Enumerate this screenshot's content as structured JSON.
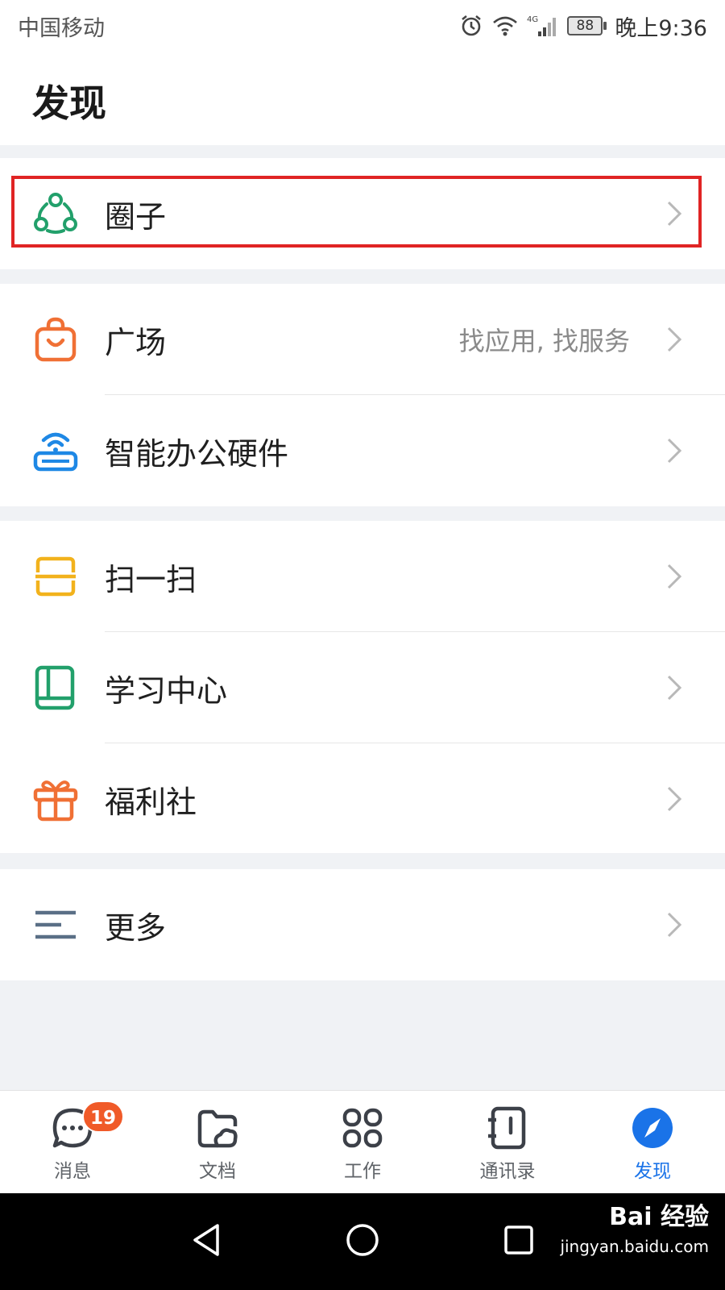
{
  "status_bar": {
    "carrier": "中国移动",
    "network": "4G",
    "battery": "88",
    "time": "晚上9:36"
  },
  "page": {
    "title": "发现"
  },
  "menu": {
    "circle": {
      "label": "圈子",
      "icon": "circle-network-icon",
      "color": "#22a06b"
    },
    "plaza": {
      "label": "广场",
      "sub": "找应用, 找服务",
      "icon": "shopping-bag-icon",
      "color": "#f07035"
    },
    "hardware": {
      "label": "智能办公硬件",
      "icon": "router-icon",
      "color": "#1e88e5"
    },
    "scan": {
      "label": "扫一扫",
      "icon": "scan-icon",
      "color": "#f2b21c"
    },
    "learning": {
      "label": "学习中心",
      "icon": "book-icon",
      "color": "#22a06b"
    },
    "welfare": {
      "label": "福利社",
      "icon": "gift-icon",
      "color": "#f07035"
    },
    "more": {
      "label": "更多",
      "icon": "menu-lines-icon",
      "color": "#5a6f86"
    }
  },
  "tabbar": {
    "messages": {
      "label": "消息",
      "badge": "19",
      "icon": "chat-icon"
    },
    "docs": {
      "label": "文档",
      "icon": "folder-icon"
    },
    "work": {
      "label": "工作",
      "icon": "apps-grid-icon"
    },
    "contacts": {
      "label": "通讯录",
      "icon": "address-book-icon"
    },
    "discover": {
      "label": "发现",
      "icon": "compass-icon",
      "active_color": "#1a73e8"
    }
  },
  "watermark": {
    "brand": "Bai 经验",
    "url": "jingyan.baidu.com"
  }
}
